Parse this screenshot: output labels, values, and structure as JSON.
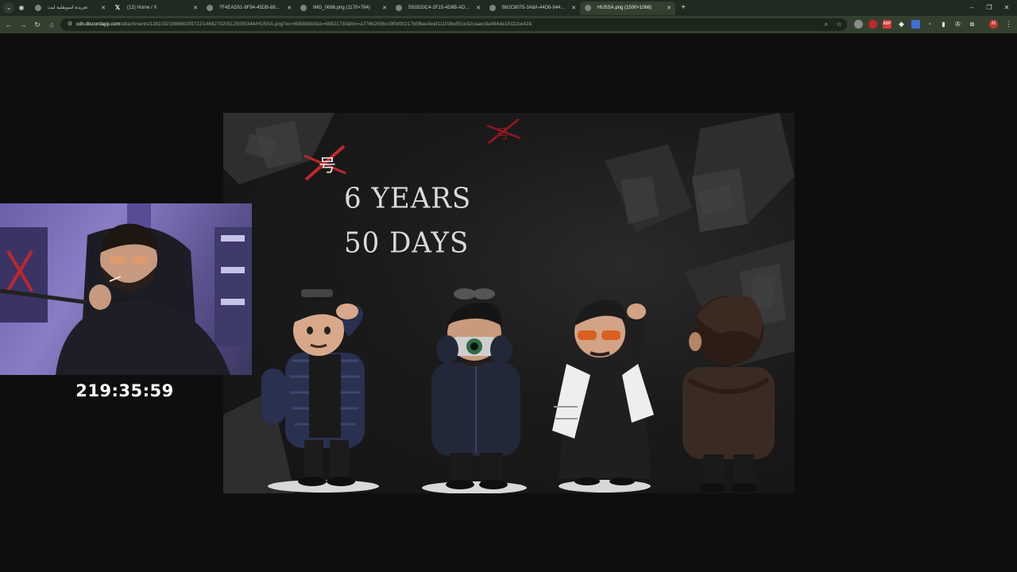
{
  "browser": {
    "tabs": [
      {
        "label": "تغريدة اسويقلية ليث",
        "favicon": "globe-icon",
        "active": false
      },
      {
        "label": "(12) Home / X",
        "favicon": "x-logo-icon",
        "active": false
      },
      {
        "label": "7F4EAD51-9F94-45DB-88A9-F5",
        "favicon": "image-icon",
        "active": false
      },
      {
        "label": "IMG_0686.png (1170×764)",
        "favicon": "image-icon",
        "active": false
      },
      {
        "label": "591B20C4-2F15-4D6B-AD9A-9",
        "favicon": "image-icon",
        "active": false
      },
      {
        "label": "B62C8075-3A8A-44D6-944F-5",
        "favicon": "image-icon",
        "active": false
      },
      {
        "label": "HUSSA.png (1500×1066)",
        "favicon": "image-icon",
        "active": true
      }
    ],
    "url": {
      "host": "cdn.discordapp.com",
      "path": "/attachments/1281032198669209722/1468270205125005344/HUSSA.png?ex=698368b0&is=69821730&hm=a77662056cc9f0d00217b5f6ee9eef11103be55ce32caaec9a494de18322ce42&"
    },
    "theme_color": "#34402f"
  },
  "artwork": {
    "line1": "6 YEARS",
    "line2": "50 DAYS",
    "accent_color": "#c0272d"
  },
  "stream": {
    "timer": "219:35:59"
  }
}
